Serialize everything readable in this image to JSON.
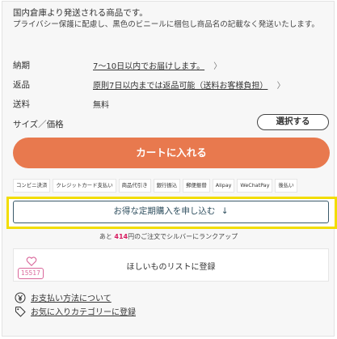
{
  "notice": {
    "title": "国内倉庫より発送される商品です。",
    "body": "プライバシー保護に配慮し、黒色のビニールに梱包し商品名の記載なく発送いたします。"
  },
  "details": [
    {
      "label": "納期",
      "value": "7〜10日以内でお届けします。",
      "link": true
    },
    {
      "label": "返品",
      "value": "原則7日以内までは返品可能（送料お客様負担）",
      "link": true
    },
    {
      "label": "送料",
      "value": "無料",
      "link": false
    }
  ],
  "size_price": {
    "label": "サイズ／価格",
    "button": "選択する"
  },
  "cart_button": "カートに入れる",
  "payment_methods": [
    "コンビニ決済",
    "クレジットカード支払い",
    "商品代引き",
    "銀行振込",
    "郵便振替",
    "Alipay",
    "WeChatPay",
    "後払い"
  ],
  "subscribe": {
    "label": "お得な定期購入を申し込む",
    "arrow": "↓"
  },
  "rank": {
    "prefix": "あと",
    "amount": "414",
    "suffix": "円のご注文でシルバーにランクアップ"
  },
  "wishlist": {
    "count": "15517",
    "label": "ほしいものリストに登録"
  },
  "links": [
    {
      "icon": "yen-circle-icon",
      "label": "お支払い方法について"
    },
    {
      "icon": "tag-icon",
      "label": "お気に入りカテゴリーに登録"
    }
  ],
  "chevron": "〉",
  "colors": {
    "accent": "#e8794e",
    "highlight": "#f2dd00",
    "pink": "#d9669a"
  }
}
